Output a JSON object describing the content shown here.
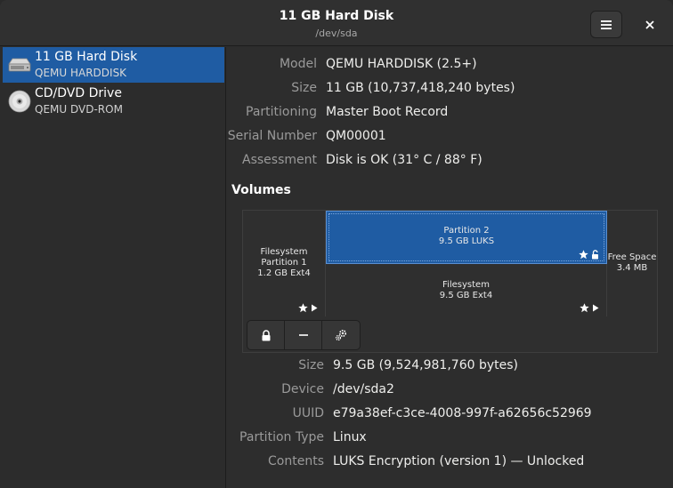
{
  "window": {
    "title": "11 GB Hard Disk",
    "subtitle": "/dev/sda"
  },
  "header": {
    "menu_icon": "hamburger-menu-icon",
    "close_label": "×"
  },
  "sidebar": {
    "items": [
      {
        "name": "11 GB Hard Disk",
        "sub": "QEMU HARDDISK",
        "icon": "hard-disk-icon",
        "selected": true
      },
      {
        "name": "CD/DVD Drive",
        "sub": "QEMU DVD-ROM",
        "icon": "optical-disc-icon",
        "selected": false
      }
    ]
  },
  "disk_properties": [
    {
      "label": "Model",
      "value": "QEMU HARDDISK (2.5+)"
    },
    {
      "label": "Size",
      "value": "11 GB (10,737,418,240 bytes)"
    },
    {
      "label": "Partitioning",
      "value": "Master Boot Record"
    },
    {
      "label": "Serial Number",
      "value": "QM00001"
    },
    {
      "label": "Assessment",
      "value": "Disk is OK (31° C / 88° F)"
    }
  ],
  "volumes": {
    "heading": "Volumes",
    "segments": {
      "fs1": {
        "line1": "Filesystem",
        "line2": "Partition 1",
        "line3": "1.2 GB Ext4"
      },
      "p2": {
        "line1": "Partition 2",
        "line2": "9.5 GB LUKS"
      },
      "fs2": {
        "line1": "Filesystem",
        "line2": "9.5 GB Ext4"
      },
      "free": {
        "line1": "Free Space",
        "line2": "3.4 MB"
      }
    },
    "toolbar": [
      "lock-icon",
      "minus-icon",
      "gears-icon"
    ]
  },
  "partition_properties": [
    {
      "label": "Size",
      "value": "9.5 GB (9,524,981,760 bytes)"
    },
    {
      "label": "Device",
      "value": "/dev/sda2"
    },
    {
      "label": "UUID",
      "value": "e79a38ef-c3ce-4008-997f-a62656c52969"
    },
    {
      "label": "Partition Type",
      "value": "Linux"
    },
    {
      "label": "Contents",
      "value": "LUKS Encryption (version 1) — Unlocked"
    }
  ],
  "colors": {
    "accent": "#1f5ca3",
    "window_bg": "#2d2d2d",
    "label_text": "#9a9a9a"
  }
}
